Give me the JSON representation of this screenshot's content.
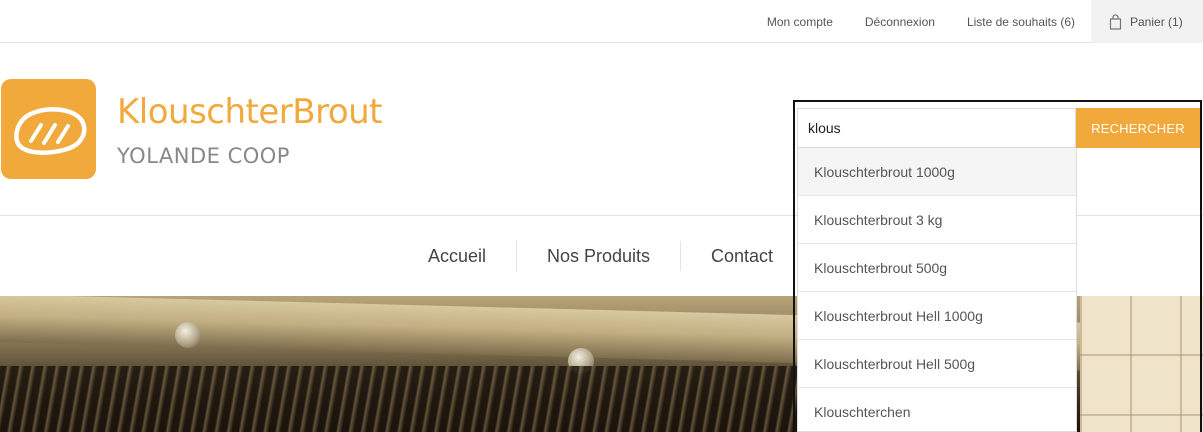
{
  "topbar": {
    "links": [
      "Mon compte",
      "Déconnexion",
      "Liste de souhaits (6)"
    ],
    "cart_label": "Panier (1)",
    "cart_icon": "shopping-bag-icon"
  },
  "brand": {
    "logo_icon": "bread-loaf-icon",
    "title": "KlouschterBrout",
    "subtitle": "YOLANDE COOP",
    "accent_color": "#f2a93b"
  },
  "nav": {
    "items": [
      "Accueil",
      "Nos Produits",
      "Contact"
    ]
  },
  "search": {
    "value": "klous",
    "button_label": "RECHERCHER",
    "suggestions": [
      "Klouschterbrout 1000g",
      "Klouschterbrout 3 kg",
      "Klouschterbrout 500g",
      "Klouschterbrout Hell 1000g",
      "Klouschterbrout Hell 500g",
      "Klouschterchen"
    ]
  }
}
